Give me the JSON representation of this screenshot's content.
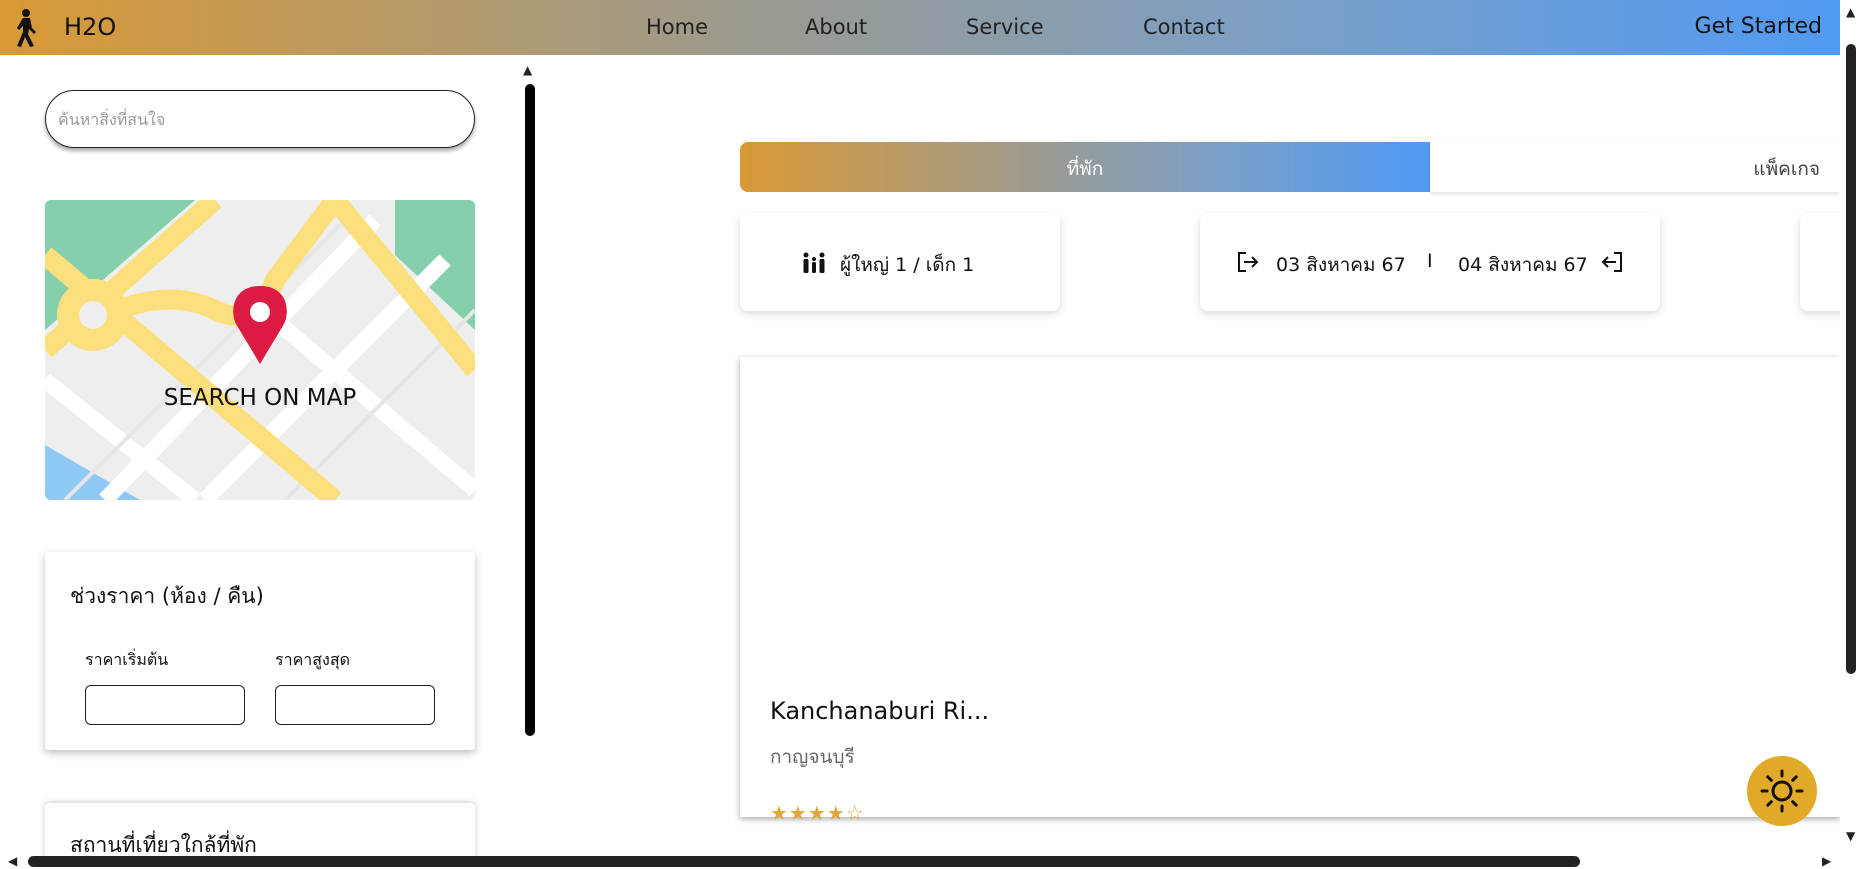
{
  "header": {
    "brand": "H2O",
    "nav": [
      "Home",
      "About",
      "Service",
      "Contact"
    ],
    "cta": "Get Started"
  },
  "sidebar": {
    "search_placeholder": "ค้นหาสิ่งที่สนใจ",
    "map_label": "SEARCH ON MAP",
    "price": {
      "title": "ช่วงราคา (ห้อง / คืน)",
      "min_label": "ราคาเริ่มต้น",
      "max_label": "ราคาสูงสุด"
    },
    "nearby_title": "สถานที่เที่ยวใกล้ที่พัก"
  },
  "tabs": [
    "ที่พัก",
    "แพ็คเกจ"
  ],
  "guests": "ผู้ใหญ่ 1 /  เด็ก 1",
  "dates": {
    "checkin": "03 สิงหาคม 67",
    "separator": "I",
    "checkout": "04 สิงหาคม 67"
  },
  "hotel": {
    "name": "Kanchanaburi Ri...",
    "location": "กาญจนบุรี",
    "rating": 4.5
  },
  "colors": {
    "gradient_start": "#d99935",
    "gradient_end": "#4f9af5",
    "map_pin": "#dc1b43",
    "theme_button": "#e1a928"
  }
}
